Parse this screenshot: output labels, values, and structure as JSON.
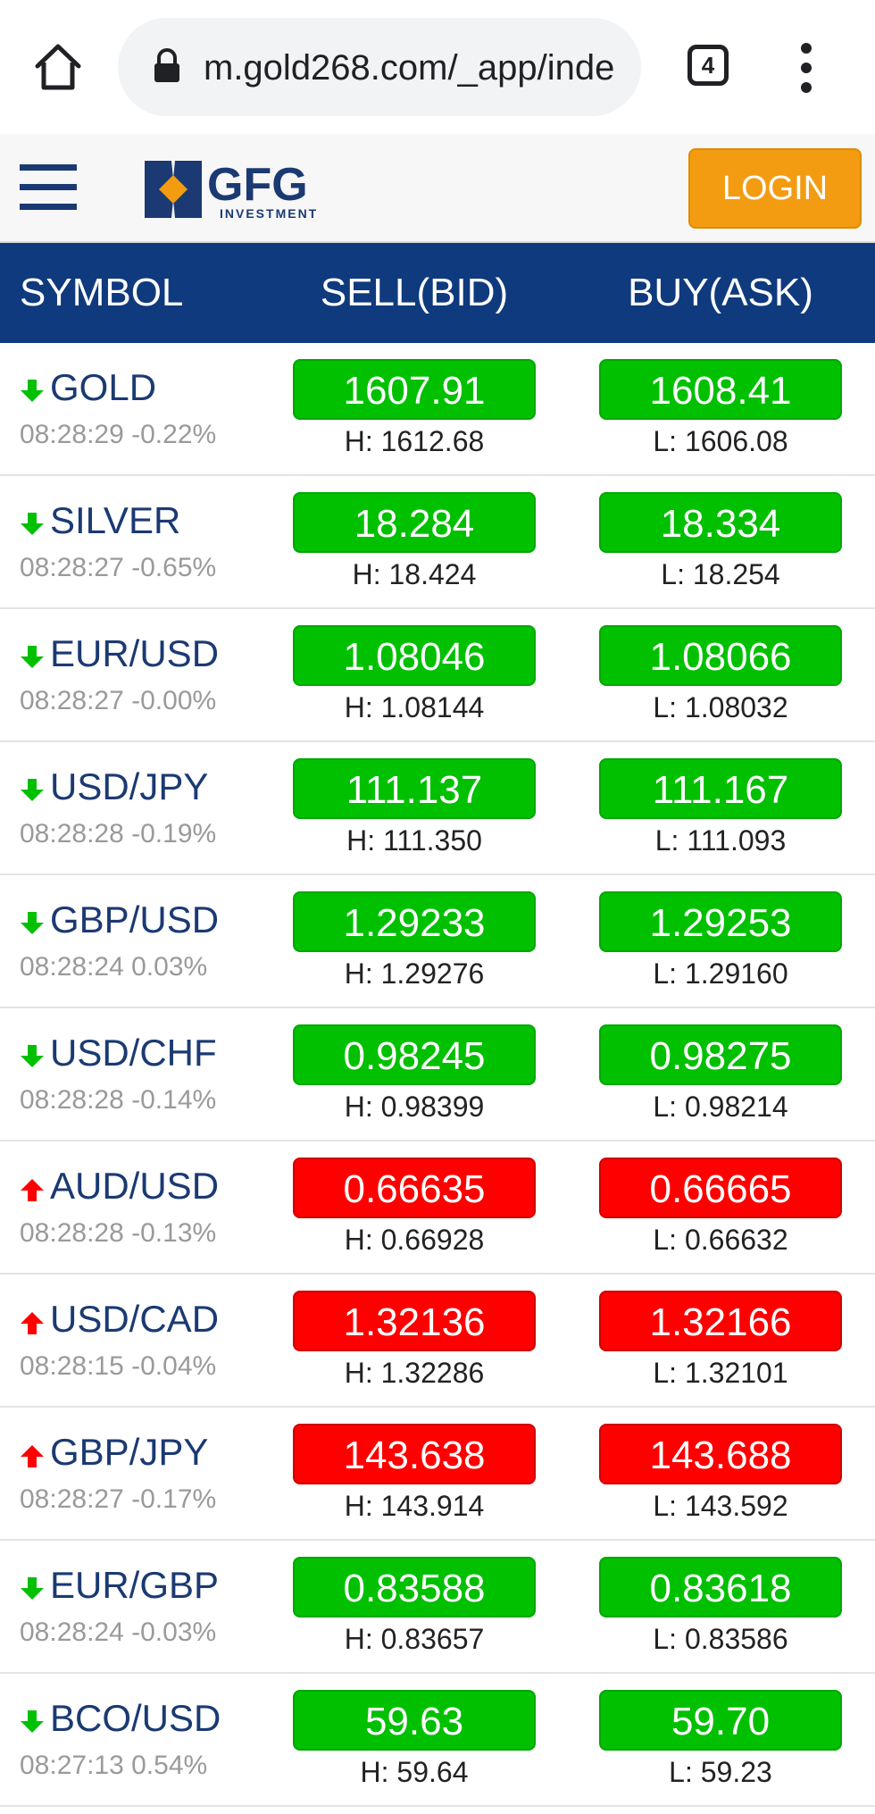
{
  "browser": {
    "url": "m.gold268.com/_app/inde",
    "tab_count": "4"
  },
  "header": {
    "logo_text": "GFG",
    "logo_subtext": "INVESTMENT",
    "login_label": "LOGIN"
  },
  "table": {
    "headers": {
      "symbol": "SYMBOL",
      "sell": "SELL(BID)",
      "buy": "BUY(ASK)"
    },
    "colors": {
      "down": "#00c000",
      "up": "#ff0000"
    },
    "rows": [
      {
        "symbol": "GOLD",
        "time": "08:28:29",
        "change": "-0.22%",
        "direction": "down",
        "sell": "1607.91",
        "buy": "1608.41",
        "high": "H: 1612.68",
        "low": "L: 1606.08"
      },
      {
        "symbol": "SILVER",
        "time": "08:28:27",
        "change": "-0.65%",
        "direction": "down",
        "sell": "18.284",
        "buy": "18.334",
        "high": "H: 18.424",
        "low": "L: 18.254"
      },
      {
        "symbol": "EUR/USD",
        "time": "08:28:27",
        "change": "-0.00%",
        "direction": "down",
        "sell": "1.08046",
        "buy": "1.08066",
        "high": "H: 1.08144",
        "low": "L: 1.08032"
      },
      {
        "symbol": "USD/JPY",
        "time": "08:28:28",
        "change": "-0.19%",
        "direction": "down",
        "sell": "111.137",
        "buy": "111.167",
        "high": "H: 111.350",
        "low": "L: 111.093"
      },
      {
        "symbol": "GBP/USD",
        "time": "08:28:24",
        "change": "0.03%",
        "direction": "down",
        "sell": "1.29233",
        "buy": "1.29253",
        "high": "H: 1.29276",
        "low": "L: 1.29160"
      },
      {
        "symbol": "USD/CHF",
        "time": "08:28:28",
        "change": "-0.14%",
        "direction": "down",
        "sell": "0.98245",
        "buy": "0.98275",
        "high": "H: 0.98399",
        "low": "L: 0.98214"
      },
      {
        "symbol": "AUD/USD",
        "time": "08:28:28",
        "change": "-0.13%",
        "direction": "up",
        "sell": "0.66635",
        "buy": "0.66665",
        "high": "H: 0.66928",
        "low": "L: 0.66632"
      },
      {
        "symbol": "USD/CAD",
        "time": "08:28:15",
        "change": "-0.04%",
        "direction": "up",
        "sell": "1.32136",
        "buy": "1.32166",
        "high": "H: 1.32286",
        "low": "L: 1.32101"
      },
      {
        "symbol": "GBP/JPY",
        "time": "08:28:27",
        "change": "-0.17%",
        "direction": "up",
        "sell": "143.638",
        "buy": "143.688",
        "high": "H: 143.914",
        "low": "L: 143.592"
      },
      {
        "symbol": "EUR/GBP",
        "time": "08:28:24",
        "change": "-0.03%",
        "direction": "down",
        "sell": "0.83588",
        "buy": "0.83618",
        "high": "H: 0.83657",
        "low": "L: 0.83586"
      },
      {
        "symbol": "BCO/USD",
        "time": "08:27:13",
        "change": "0.54%",
        "direction": "down",
        "sell": "59.63",
        "buy": "59.70",
        "high": "H: 59.64",
        "low": "L: 59.23"
      }
    ]
  }
}
